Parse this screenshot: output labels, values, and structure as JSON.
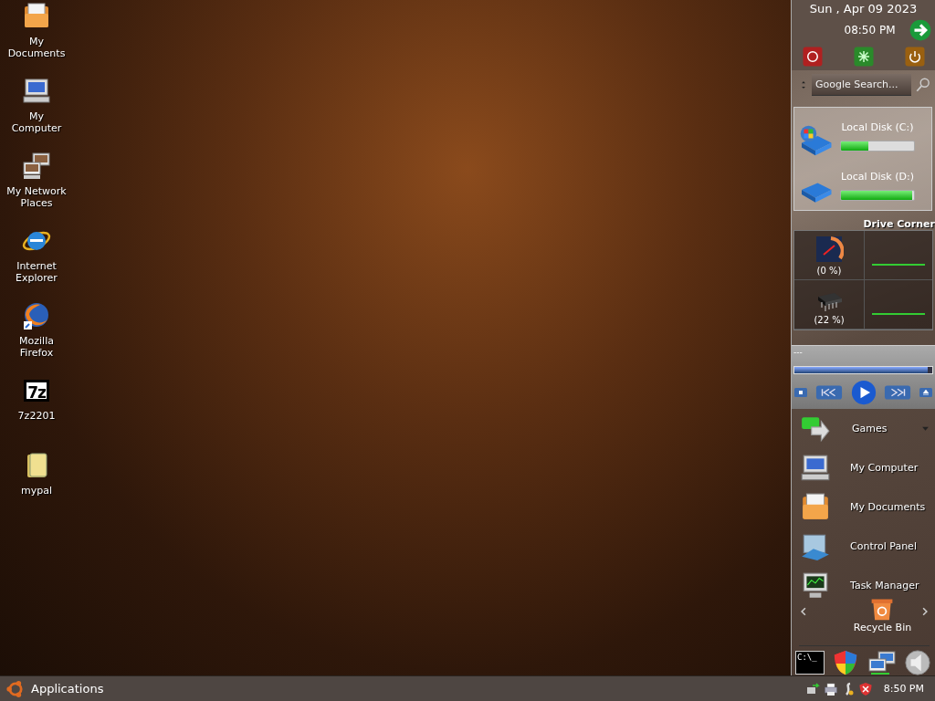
{
  "desktop_icons": [
    {
      "label": "My Documents",
      "kind": "documents"
    },
    {
      "label": "My Computer",
      "kind": "computer"
    },
    {
      "label": "My Network Places",
      "kind": "network"
    },
    {
      "label": "Internet Explorer",
      "kind": "ie"
    },
    {
      "label": "Mozilla Firefox",
      "kind": "firefox"
    },
    {
      "label": "7z2201",
      "kind": "archive",
      "glyph": "7z"
    },
    {
      "label": "mypal",
      "kind": "folder"
    }
  ],
  "sidebar": {
    "clock": {
      "date": "Sun , Apr 09 2023",
      "time": "08:50 PM"
    },
    "power_buttons": [
      {
        "kind": "stop"
      },
      {
        "kind": "restart"
      },
      {
        "kind": "power"
      }
    ],
    "search": {
      "placeholder": "Google Search..."
    },
    "drives": [
      {
        "name": "Local Disk (C:)",
        "kind": "system",
        "level": 0.37
      },
      {
        "name": "Local Disk (D:)",
        "kind": "data",
        "level": 0.98
      }
    ],
    "drive_corner_title": "Drive Corner",
    "monitors": [
      {
        "kind": "cpu",
        "reading": "(0 %)"
      },
      {
        "kind": "memory",
        "reading": "(22 %)"
      }
    ],
    "player": {
      "title": "---",
      "level": 0.97
    },
    "launcher": {
      "group": {
        "label": "Games"
      },
      "items": [
        {
          "label": "My Computer",
          "kind": "computer"
        },
        {
          "label": "My Documents",
          "kind": "documents"
        },
        {
          "label": "Control Panel",
          "kind": "panel"
        },
        {
          "label": "Task Manager",
          "kind": "taskmgr"
        }
      ],
      "recycle_bin": "Recycle Bin"
    },
    "dock": [
      {
        "kind": "terminal",
        "glyph": "C:\\_"
      },
      {
        "kind": "shield"
      },
      {
        "kind": "network"
      },
      {
        "kind": "speaker"
      }
    ]
  },
  "taskbar": {
    "menu": "Applications",
    "tray": [
      {
        "kind": "network"
      },
      {
        "kind": "printer"
      },
      {
        "kind": "update"
      },
      {
        "kind": "shield"
      }
    ],
    "clock": "8:50 PM"
  }
}
